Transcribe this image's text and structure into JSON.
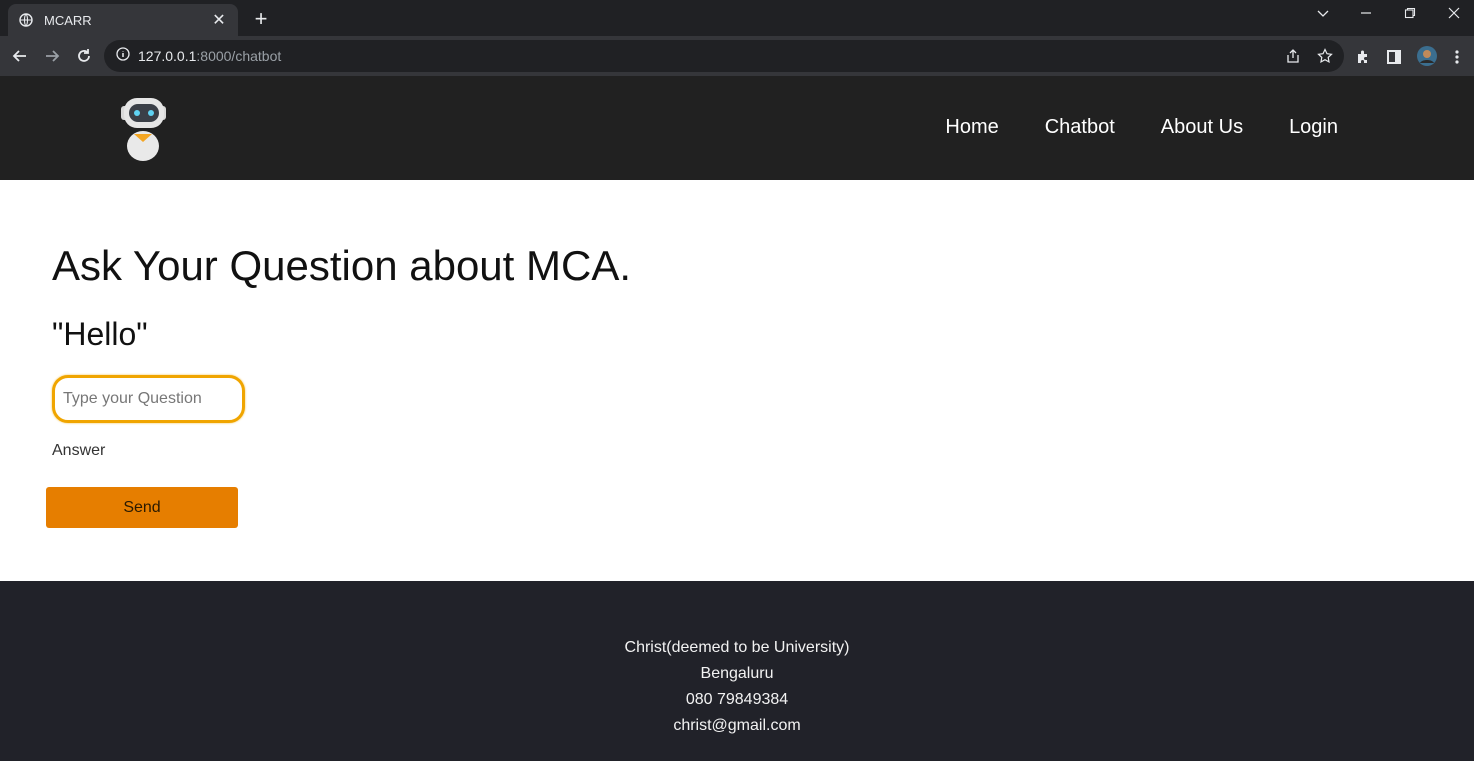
{
  "browser": {
    "tab_title": "MCARR",
    "url_host": "127.0.0.1",
    "url_path": ":8000/chatbot"
  },
  "header": {
    "nav": [
      "Home",
      "Chatbot",
      "About Us",
      "Login"
    ]
  },
  "main": {
    "title": "Ask Your Question about MCA.",
    "greeting": "\"Hello\"",
    "input_placeholder": "Type your Question",
    "answer_label": "Answer",
    "send_label": "Send"
  },
  "footer": {
    "lines": [
      "Christ(deemed to be University)",
      "Bengaluru",
      "080 79849384",
      "christ@gmail.com"
    ]
  },
  "colors": {
    "accent": "#e67e00",
    "input_border": "#f0a500",
    "header_bg": "#212121",
    "footer_bg": "#212229"
  }
}
